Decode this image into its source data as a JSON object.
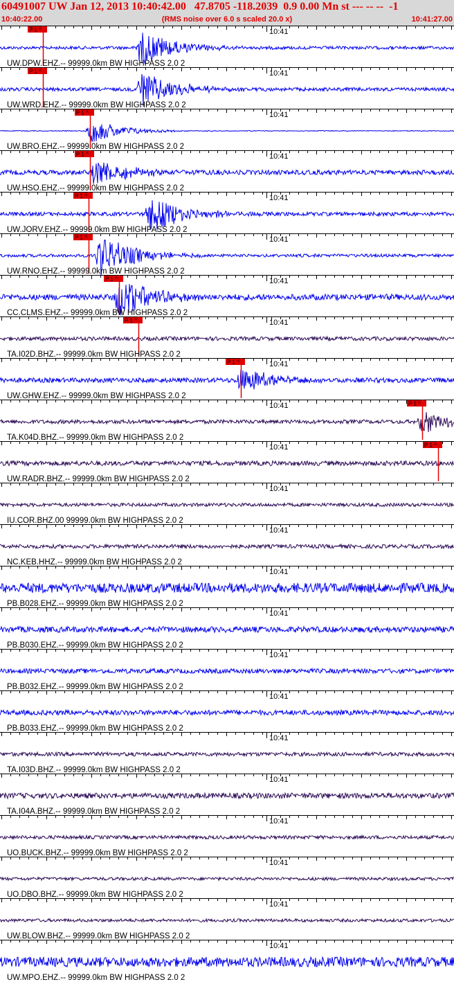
{
  "header": {
    "title": "60491007 UW Jan 12, 2013 10:40:42.00   47.8705 -118.2039  0.9 0.00 Mn st --- -- --  -1",
    "start_time": "10:40:22.00",
    "subtitle": "(RMS noise over 6.0 s scaled 20.0 x)",
    "end_time": "10:41:27.00"
  },
  "time_marker_label": "10:41",
  "pick_label": "P 1 ^",
  "colors": {
    "blue": "#0000ee",
    "purple": "#2a0a55",
    "pick": "#e00000",
    "header_bg": "#d8d8d8"
  },
  "traces": [
    {
      "label": "UW.DPW.EHZ.-- 99999.0km BW  HIGHPASS  2.0  2",
      "color": "blue",
      "pick": 0.095,
      "event": 0.31,
      "amp": 0.9,
      "noise": 0.08
    },
    {
      "label": "UW.WRD.EHZ.-- 99999.0km BW  HIGHPASS  2.0  2",
      "color": "blue",
      "pick": 0.095,
      "event": 0.31,
      "amp": 0.95,
      "noise": 0.09
    },
    {
      "label": "UW.BRO.EHZ.-- 99999.0km BW  HIGHPASS  2.0  2",
      "color": "blue",
      "pick": 0.198,
      "event": 0.2,
      "amp": 0.6,
      "noise": 0.02
    },
    {
      "label": "UW.HSO.EHZ.-- 99999.0km BW  HIGHPASS  2.0  2",
      "color": "blue",
      "pick": 0.198,
      "event": 0.21,
      "amp": 0.7,
      "noise": 0.12
    },
    {
      "label": "UW.JORV.EHZ.-- 99999.0km BW  HIGHPASS  2.0  2",
      "color": "blue",
      "pick": 0.195,
      "event": 0.33,
      "amp": 1.0,
      "noise": 0.1
    },
    {
      "label": "UW.RNO.EHZ.-- 99999.0km BW  HIGHPASS  2.0  2",
      "color": "blue",
      "pick": 0.195,
      "event": 0.22,
      "amp": 1.1,
      "noise": 0.08
    },
    {
      "label": "CC.CLMS.EHZ.-- 99999.0km BW  HIGHPASS  2.0  2",
      "color": "blue",
      "pick": 0.262,
      "event": 0.26,
      "amp": 1.0,
      "noise": 0.15
    },
    {
      "label": "TA.I02D.BHZ.-- 99999.0km BW  HIGHPASS  2.0  2",
      "color": "purple",
      "pick": 0.305,
      "event": null,
      "amp": 0.0,
      "noise": 0.1
    },
    {
      "label": "UW.GHW.EHZ.-- 99999.0km BW  HIGHPASS  2.0  2",
      "color": "blue",
      "pick": 0.53,
      "event": 0.53,
      "amp": 0.6,
      "noise": 0.12
    },
    {
      "label": "TA.K04D.BHZ.-- 99999.0km BW  HIGHPASS  2.0  2",
      "color": "purple",
      "pick": 0.93,
      "event": 0.93,
      "amp": 0.55,
      "noise": 0.1
    },
    {
      "label": "UW.RADR.BHZ.-- 99999.0km BW  HIGHPASS  2.0  2",
      "color": "purple",
      "pick": 0.965,
      "event": null,
      "amp": 0.0,
      "noise": 0.12
    },
    {
      "label": "IU.COR.BHZ.00 99999.0km BW  HIGHPASS  2.0  2",
      "color": "purple",
      "pick": null,
      "event": null,
      "amp": 0.0,
      "noise": 0.09
    },
    {
      "label": "NC.KEB.HHZ.-- 99999.0km BW  HIGHPASS  2.0  2",
      "color": "purple",
      "pick": null,
      "event": null,
      "amp": 0.0,
      "noise": 0.1
    },
    {
      "label": "PB.B028.EHZ.-- 99999.0km BW  HIGHPASS  2.0  2",
      "color": "blue",
      "pick": null,
      "event": null,
      "amp": 0.0,
      "noise": 0.25
    },
    {
      "label": "PB.B030.EHZ.-- 99999.0km BW  HIGHPASS  2.0  2",
      "color": "blue",
      "pick": null,
      "event": null,
      "amp": 0.0,
      "noise": 0.15
    },
    {
      "label": "PB.B032.EHZ.-- 99999.0km BW  HIGHPASS  2.0  2",
      "color": "blue",
      "pick": null,
      "event": null,
      "amp": 0.0,
      "noise": 0.12
    },
    {
      "label": "PB.B033.EHZ.-- 99999.0km BW  HIGHPASS  2.0  2",
      "color": "blue",
      "pick": null,
      "event": null,
      "amp": 0.0,
      "noise": 0.13
    },
    {
      "label": "TA.I03D.BHZ.-- 99999.0km BW  HIGHPASS  2.0  2",
      "color": "purple",
      "pick": null,
      "event": null,
      "amp": 0.0,
      "noise": 0.1
    },
    {
      "label": "TA.I04A.BHZ.-- 99999.0km BW  HIGHPASS  2.0  2",
      "color": "purple",
      "pick": null,
      "event": null,
      "amp": 0.0,
      "noise": 0.14
    },
    {
      "label": "UO.BUCK.BHZ.-- 99999.0km BW  HIGHPASS  2.0  2",
      "color": "purple",
      "pick": null,
      "event": null,
      "amp": 0.0,
      "noise": 0.09
    },
    {
      "label": "UO.DBO.BHZ.-- 99999.0km BW  HIGHPASS  2.0  2",
      "color": "purple",
      "pick": null,
      "event": null,
      "amp": 0.0,
      "noise": 0.08
    },
    {
      "label": "UW.BLOW.BHZ.-- 99999.0km BW  HIGHPASS  2.0  2",
      "color": "purple",
      "pick": null,
      "event": null,
      "amp": 0.0,
      "noise": 0.08
    },
    {
      "label": "UW.MPO.EHZ.-- 99999.0km BW  HIGHPASS  2.0  2",
      "color": "blue",
      "pick": null,
      "event": null,
      "amp": 0.0,
      "noise": 0.25
    }
  ]
}
